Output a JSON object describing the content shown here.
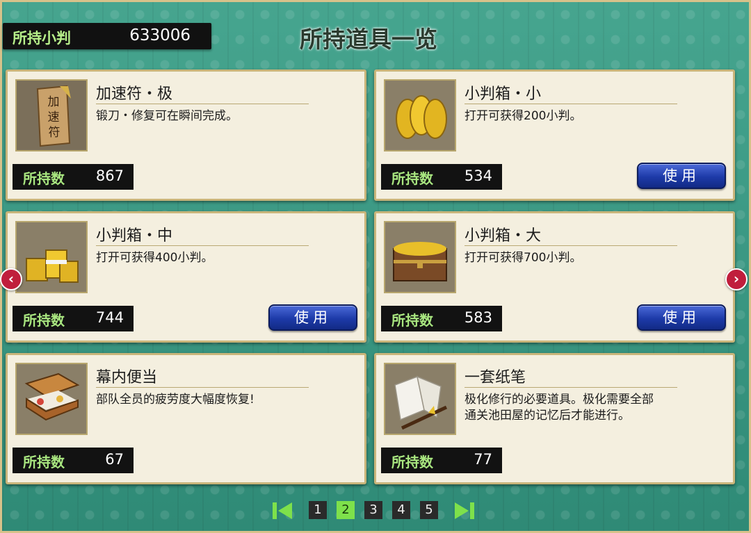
{
  "header": {
    "koban_label": "所持小判",
    "koban_value": "633006",
    "title": "所持道具一览"
  },
  "items": [
    {
      "name": "加速符・极",
      "desc": "锻刀・修复可在瞬间完成。",
      "own_label": "所持数",
      "count": "867",
      "use_label": ""
    },
    {
      "name": "小判箱・小",
      "desc": "打开可获得200小判。",
      "own_label": "所持数",
      "count": "534",
      "use_label": "使用"
    },
    {
      "name": "小判箱・中",
      "desc": "打开可获得400小判。",
      "own_label": "所持数",
      "count": "744",
      "use_label": "使用"
    },
    {
      "name": "小判箱・大",
      "desc": "打开可获得700小判。",
      "own_label": "所持数",
      "count": "583",
      "use_label": "使用"
    },
    {
      "name": "幕内便当",
      "desc": "部队全员的疲劳度大幅度恢复!",
      "own_label": "所持数",
      "count": "67",
      "use_label": ""
    },
    {
      "name": "一套纸笔",
      "desc": "极化修行的必要道具。极化需要全部\n通关池田屋的记忆后才能进行。",
      "own_label": "所持数",
      "count": "77",
      "use_label": ""
    }
  ],
  "icons": [
    "talisman-icon",
    "koban-coins-icon",
    "koban-stacks-icon",
    "treasure-chest-icon",
    "bento-box-icon",
    "paper-brush-icon"
  ],
  "icon_text": {
    "talisman": "加速符"
  },
  "nav": {
    "prev_arrow": "‹",
    "next_arrow": "›"
  },
  "pagination": {
    "pages": [
      "1",
      "2",
      "3",
      "4",
      "5"
    ],
    "current": "2"
  },
  "colors": {
    "background": "#3f9a85",
    "card": "#f4efdf",
    "button": "#1d3aa8",
    "arrow": "#c01e3c",
    "active_page": "#7ee14b"
  }
}
